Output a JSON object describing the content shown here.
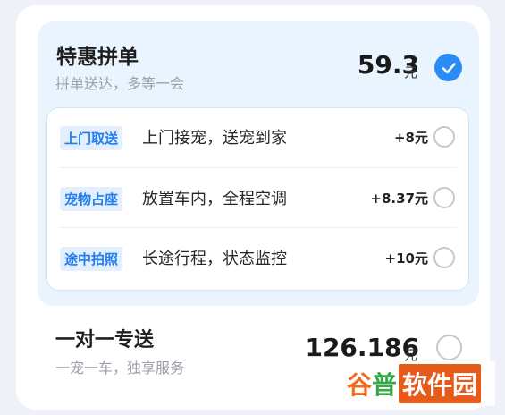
{
  "pool_option": {
    "title": "特惠拼单",
    "subtitle": "拼单送达，多等一会",
    "price": "59.3",
    "unit": "元",
    "selected": true
  },
  "addons": [
    {
      "tag": "上门取送",
      "desc": "上门接宠，送宠到家",
      "price": "+8元"
    },
    {
      "tag": "宠物占座",
      "desc": "放置车内，全程空调",
      "price": "+8.37元"
    },
    {
      "tag": "途中拍照",
      "desc": "长途行程，状态监控",
      "price": "+10元"
    }
  ],
  "direct_option": {
    "title": "一对一专送",
    "subtitle": "一宠一车，独享服务",
    "price": "126.186",
    "unit": "元",
    "selected": false
  },
  "watermark": {
    "part1": "谷",
    "part2": "普",
    "part3": "软件园"
  },
  "colors": {
    "accent": "#2a8cf6",
    "tag_text": "#1f7ef0",
    "tag_bg": "#e3efff"
  }
}
